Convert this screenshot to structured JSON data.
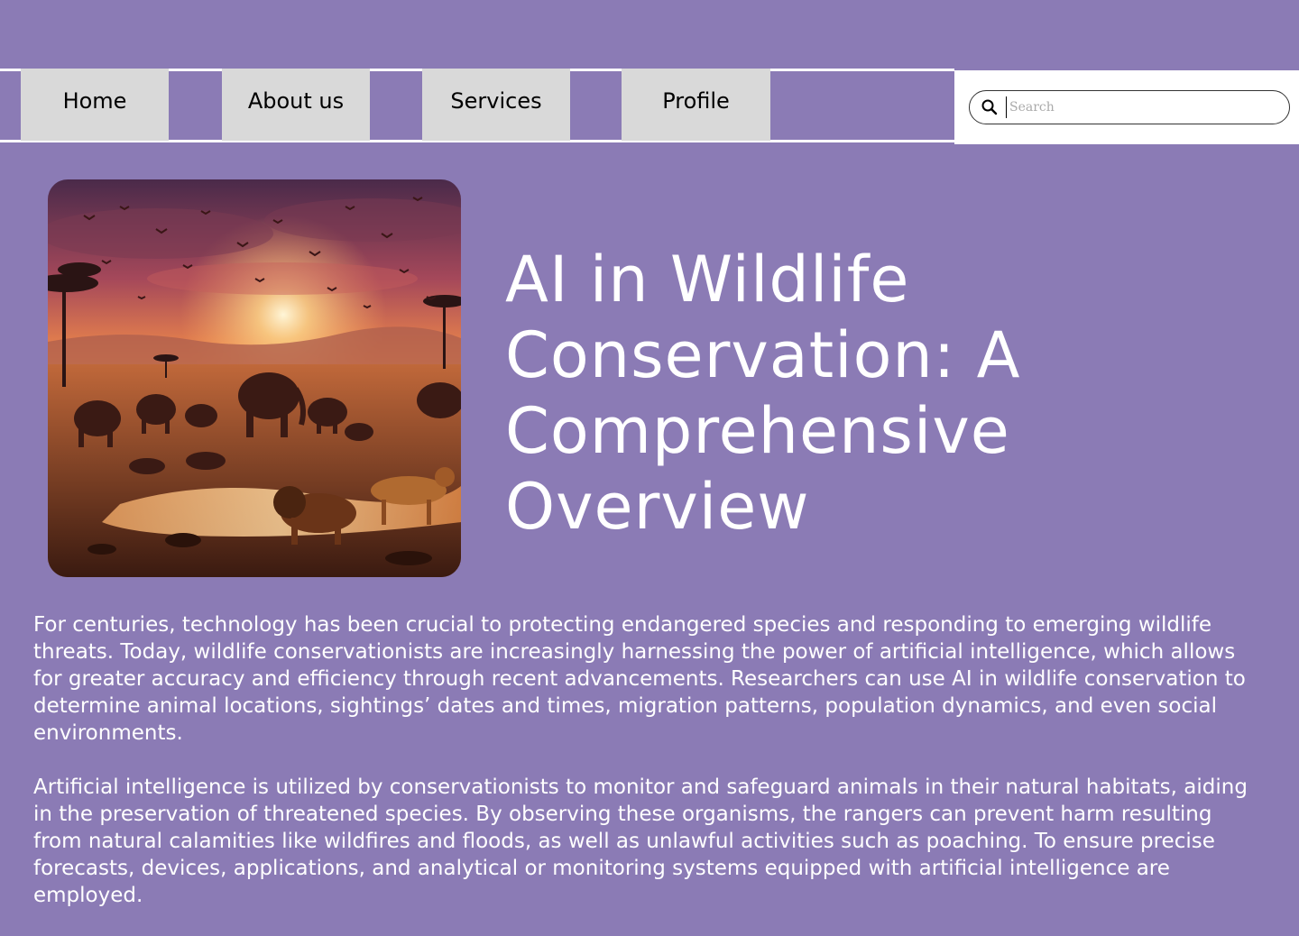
{
  "nav": {
    "items": [
      {
        "label": "Home"
      },
      {
        "label": "About us"
      },
      {
        "label": "Services"
      },
      {
        "label": "Profile"
      }
    ]
  },
  "search": {
    "placeholder": "Search",
    "value": ""
  },
  "hero": {
    "image_description": "savanna-sunset-wildlife",
    "title": "AI in Wildlife Conservation: A Comprehensive Overview"
  },
  "article": {
    "paragraphs": [
      "For centuries, technology has been crucial to protecting endangered species and responding to emerging wildlife threats. Today, wildlife conservationists are increasingly harnessing the power of artificial intelligence, which allows for greater accuracy and efficiency through recent advancements. Researchers can use AI in wildlife conservation to determine animal locations, sightings’ dates and times, migration patterns, population dynamics, and even social environments.",
      "Artificial intelligence is utilized by conservationists to monitor and safeguard animals in their natural habitats, aiding in the preservation of threatened species.  By observing these organisms, the rangers can prevent harm resulting from natural calamities like wildfires and floods, as well as unlawful activities such as poaching. To ensure precise forecasts, devices, applications, and analytical or monitoring systems equipped with artificial intelligence are employed."
    ]
  },
  "colors": {
    "background": "#8b7bb5",
    "nav_item_bg": "#d9d9d9",
    "text_light": "#ffffff"
  }
}
